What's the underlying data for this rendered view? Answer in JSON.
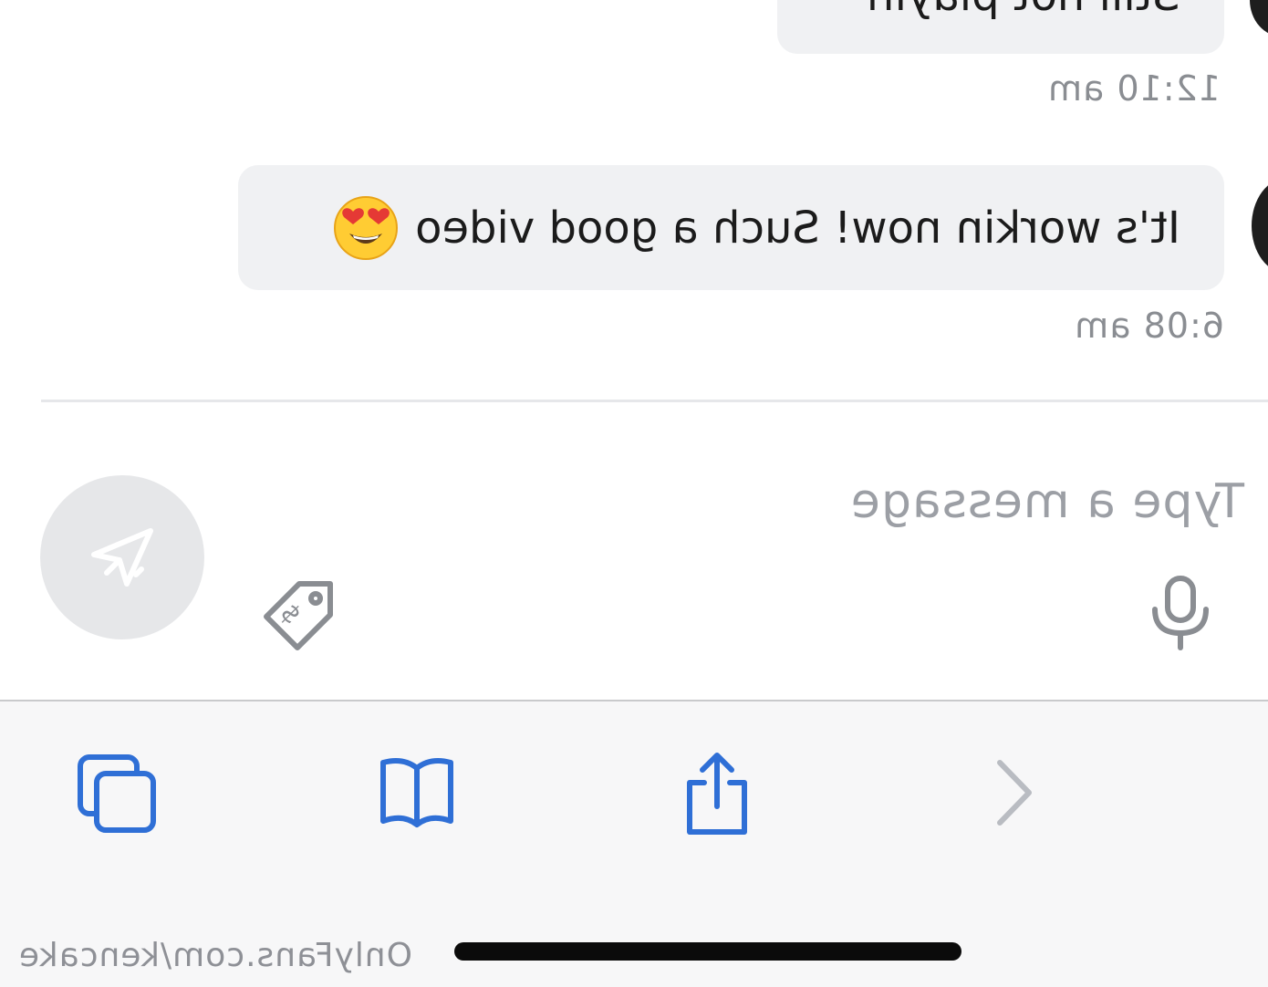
{
  "conversation": {
    "messages": [
      {
        "text": "Still not playin",
        "time": "12:10 am"
      },
      {
        "text": "It's workin now! Such a good video",
        "emoji": "heart-eyes-emoji",
        "time": "6:08 am"
      }
    ]
  },
  "composer": {
    "placeholder": "Type a message",
    "icons": [
      "microphone-icon",
      "price-tag-icon",
      "send-icon"
    ]
  },
  "browser_toolbar": {
    "icons": [
      "back-chevron-icon",
      "share-icon",
      "bookmarks-icon",
      "tabs-icon"
    ]
  },
  "watermark": "OnlyFans.com/kencake",
  "colors": {
    "bubble": "#f0f1f3",
    "accent_blue": "#2f6fd6",
    "muted_gray": "#8a8d92"
  }
}
